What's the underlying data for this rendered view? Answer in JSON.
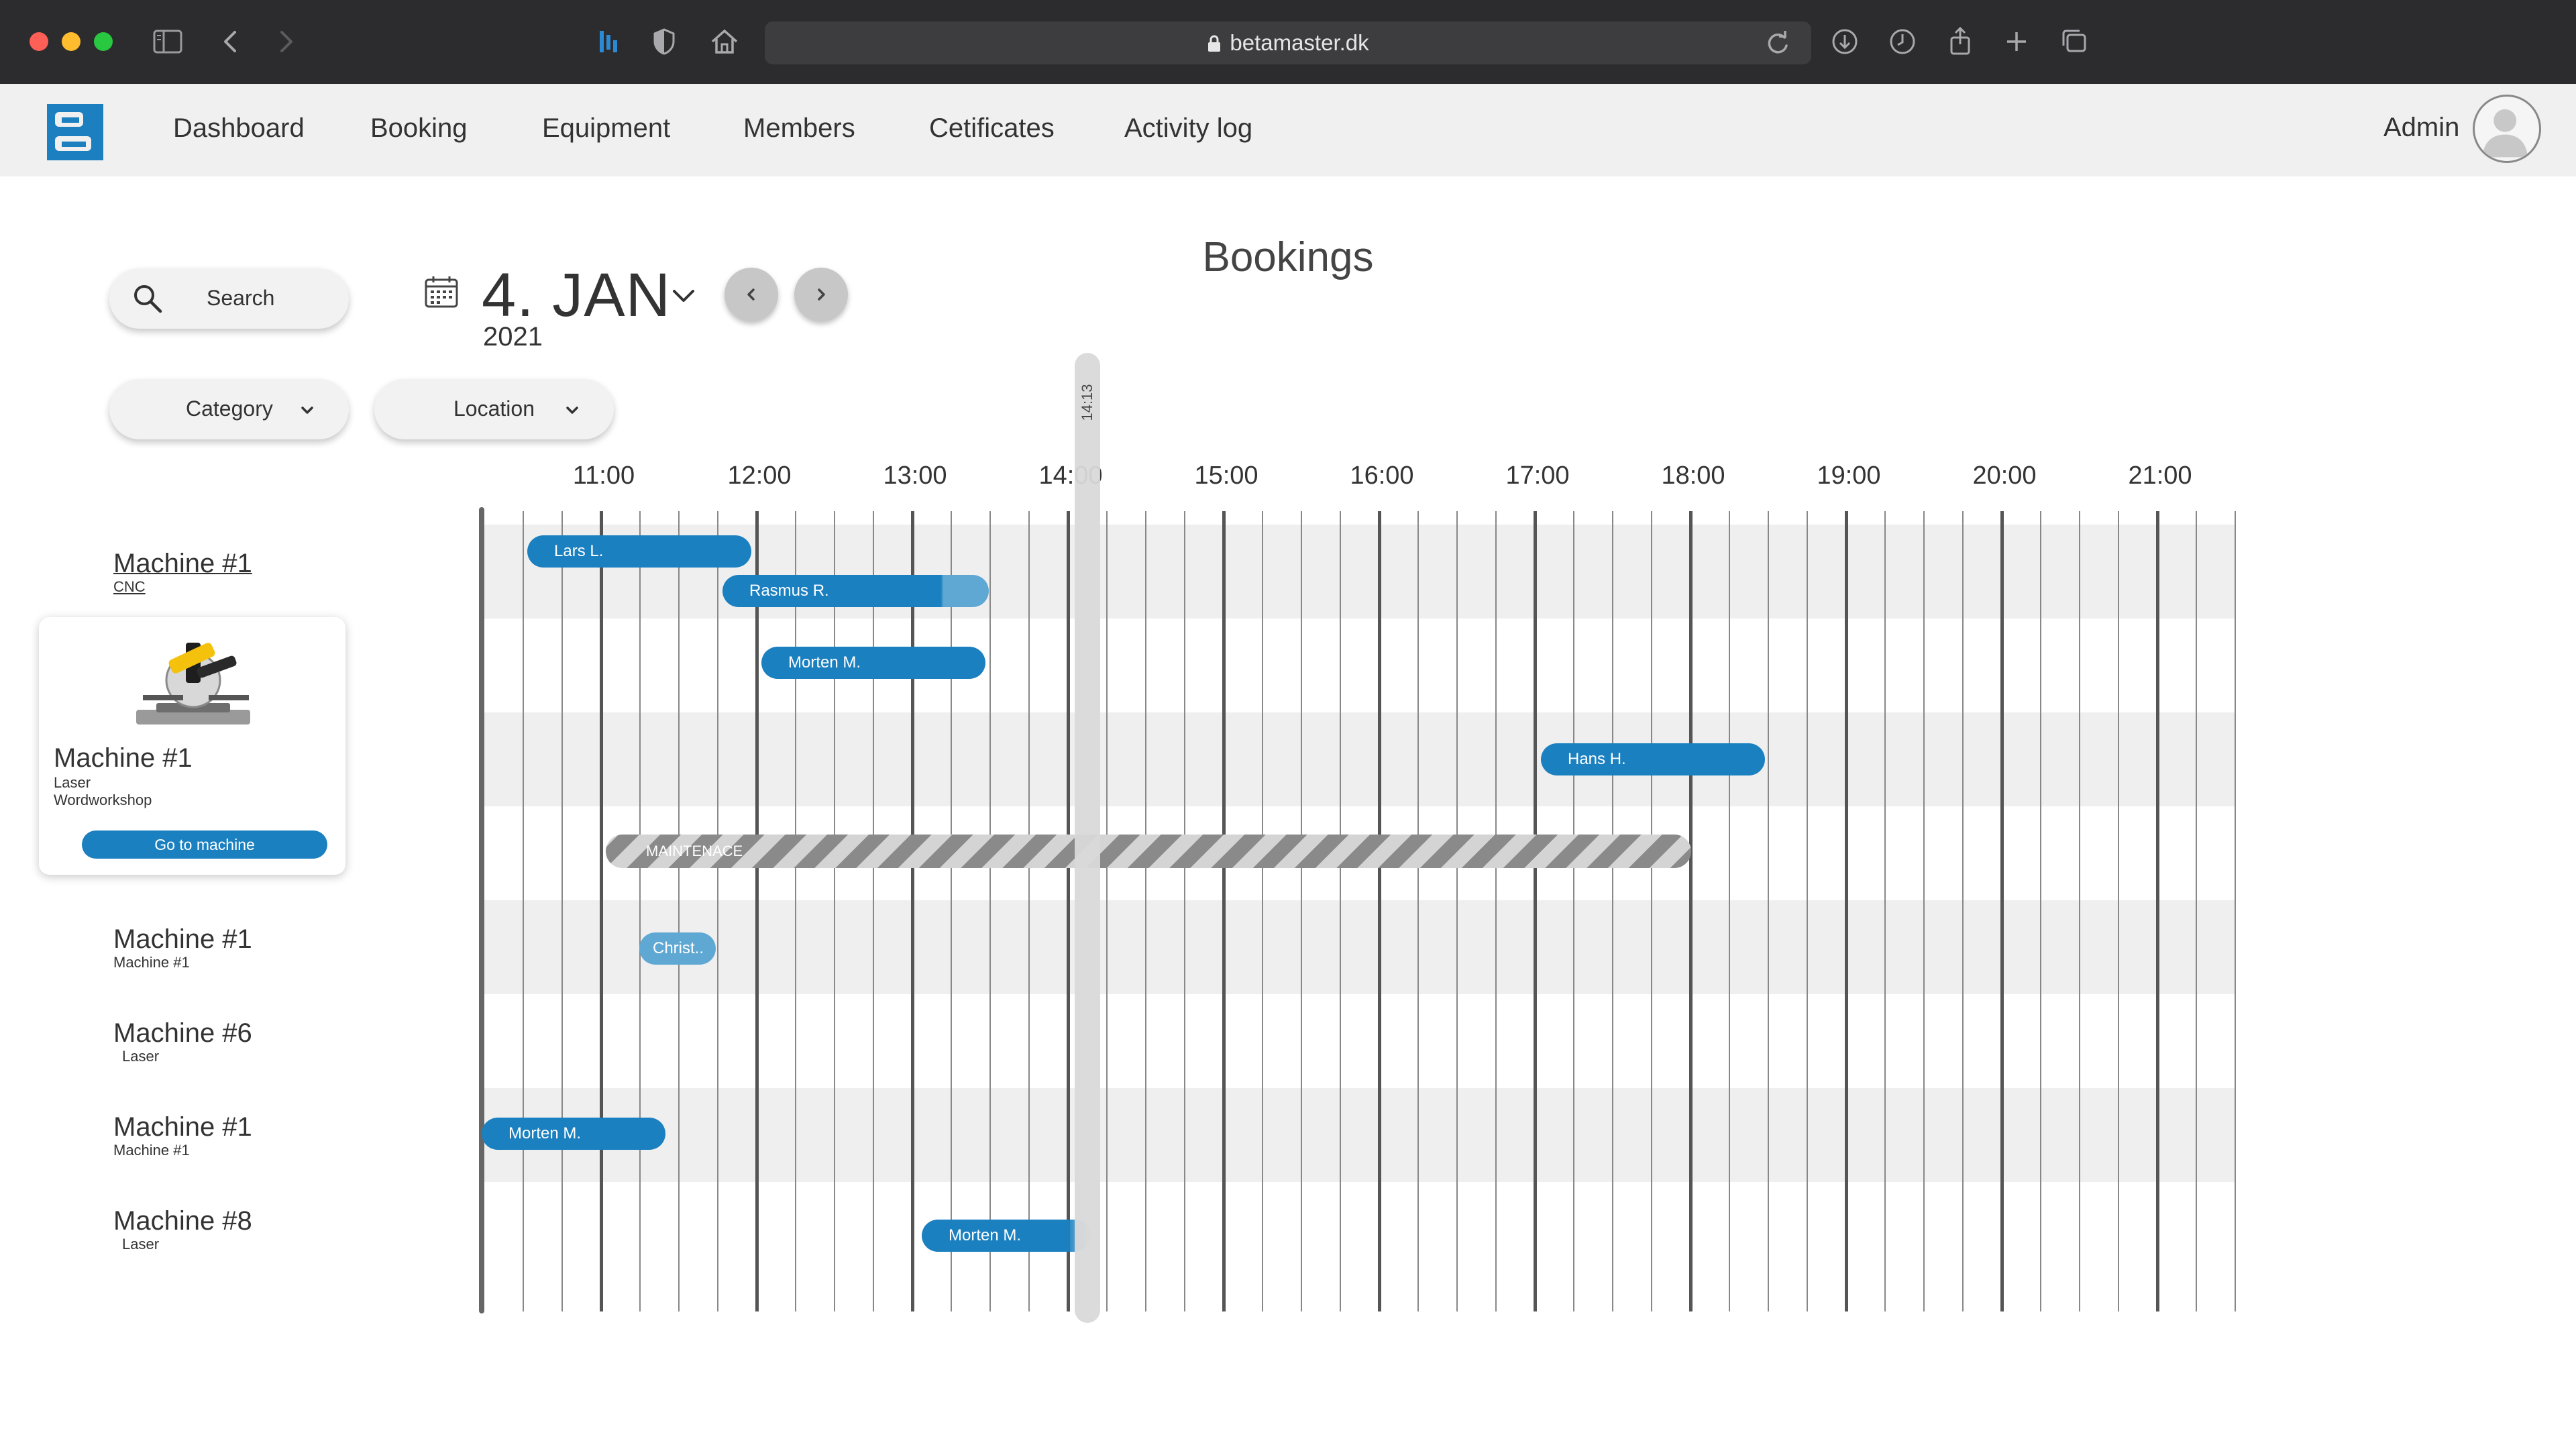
{
  "browser": {
    "url": "betamaster.dk"
  },
  "nav": {
    "items": [
      "Dashboard",
      "Booking",
      "Equipment",
      "Members",
      "Cetificates",
      "Activity log"
    ],
    "admin_label": "Admin"
  },
  "search": {
    "label": "Search"
  },
  "filters": {
    "category": "Category",
    "location": "Location"
  },
  "date": {
    "day_month": "4. JAN",
    "year": "2021"
  },
  "page_title": "Bookings",
  "timeline": {
    "hours": [
      "11:00",
      "12:00",
      "13:00",
      "14:00",
      "15:00",
      "16:00",
      "17:00",
      "18:00",
      "19:00",
      "20:00",
      "21:00"
    ],
    "now_label": "14:13"
  },
  "machines": [
    {
      "name": "Machine #1",
      "sub": "CNC"
    },
    {
      "name": "Machine #1",
      "sub": "Machine #1"
    },
    {
      "name": "Machine #6",
      "sub": "Laser"
    },
    {
      "name": "Machine #1",
      "sub": "Machine #1"
    },
    {
      "name": "Machine #8",
      "sub": "Laser"
    }
  ],
  "selected_machine": {
    "name": "Machine #1",
    "type": "Laser",
    "location": "Wordworkshop",
    "button": "Go to machine"
  },
  "bookings": [
    {
      "name": "Lars L."
    },
    {
      "name": "Rasmus R."
    },
    {
      "name": "Morten M."
    },
    {
      "name": "Hans H."
    },
    {
      "name": "MAINTENACE"
    },
    {
      "name": "Christ.."
    },
    {
      "name": "Morten M."
    },
    {
      "name": "Morten M."
    }
  ]
}
